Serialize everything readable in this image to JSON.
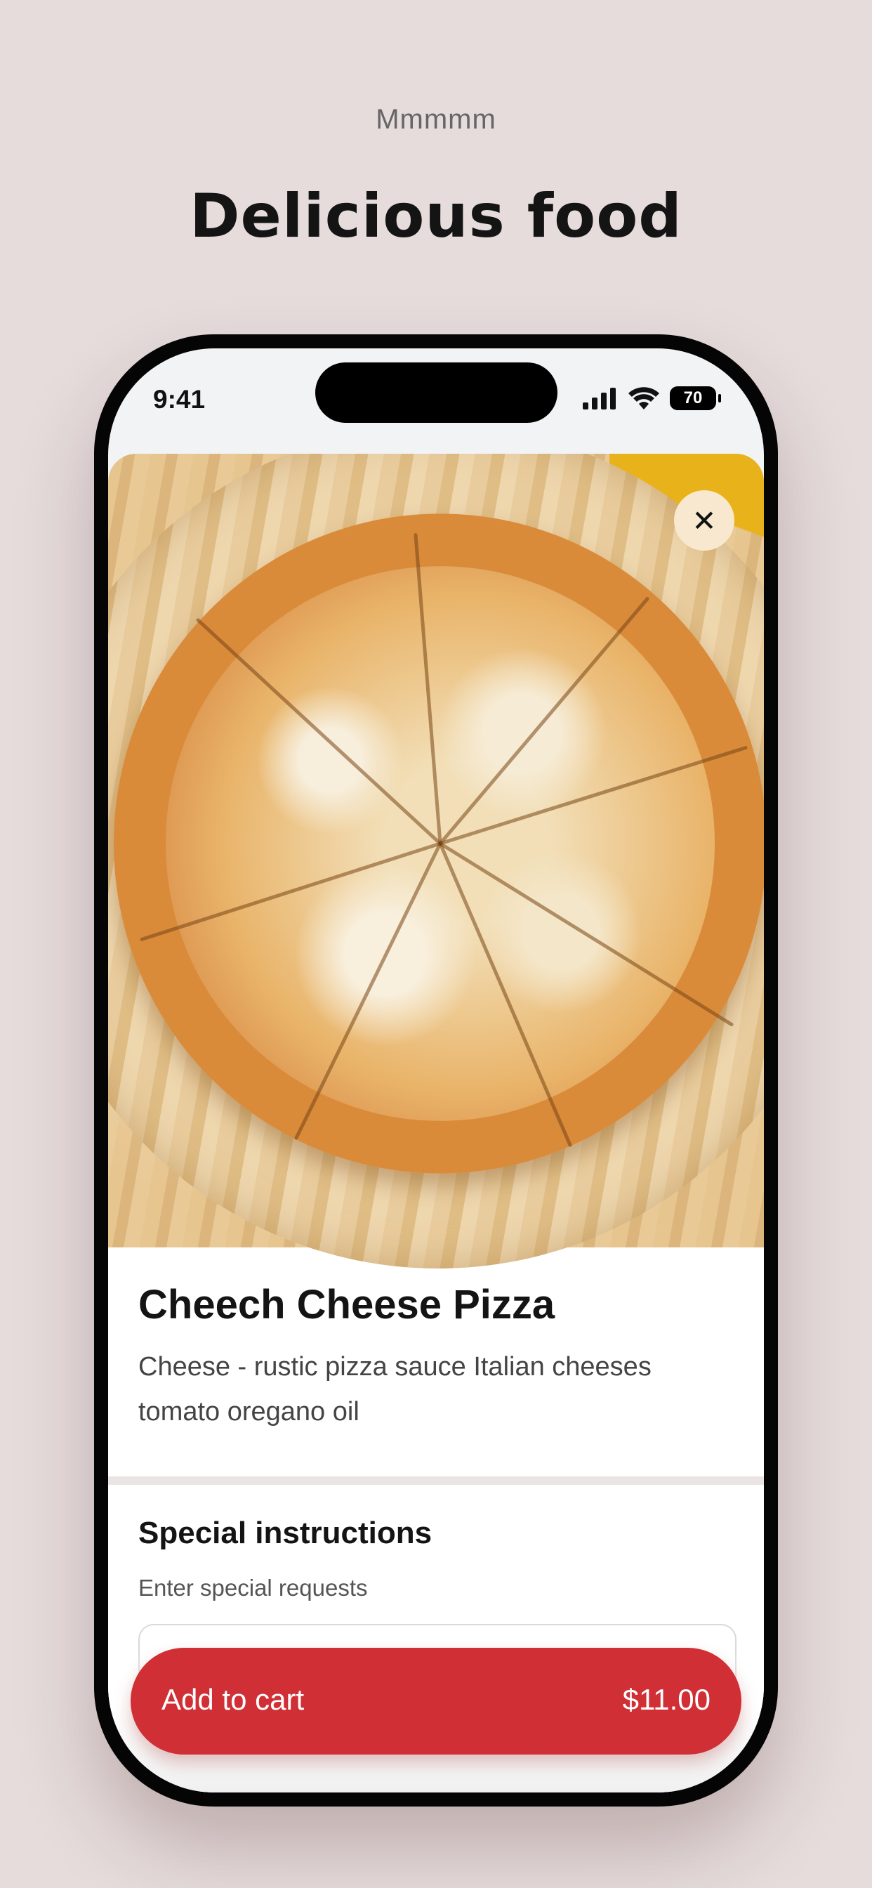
{
  "hero": {
    "eyebrow": "Mmmmm",
    "headline": "Delicious food"
  },
  "status_bar": {
    "time": "9:41",
    "battery": "70"
  },
  "item": {
    "image_alt": "Cheese pizza on a wooden board",
    "title": "Cheech Cheese Pizza",
    "description": "Cheese - rustic pizza sauce Italian cheeses tomato oregano oil"
  },
  "special_instructions": {
    "title": "Special instructions",
    "subtitle": "Enter special requests",
    "value": ""
  },
  "cart": {
    "label": "Add to cart",
    "price": "$11.00"
  },
  "icons": {
    "close": "close-icon",
    "signal": "cellular-signal-icon",
    "wifi": "wifi-icon",
    "battery": "battery-icon"
  },
  "colors": {
    "background": "#e6dcdc",
    "accent": "#d03035"
  }
}
